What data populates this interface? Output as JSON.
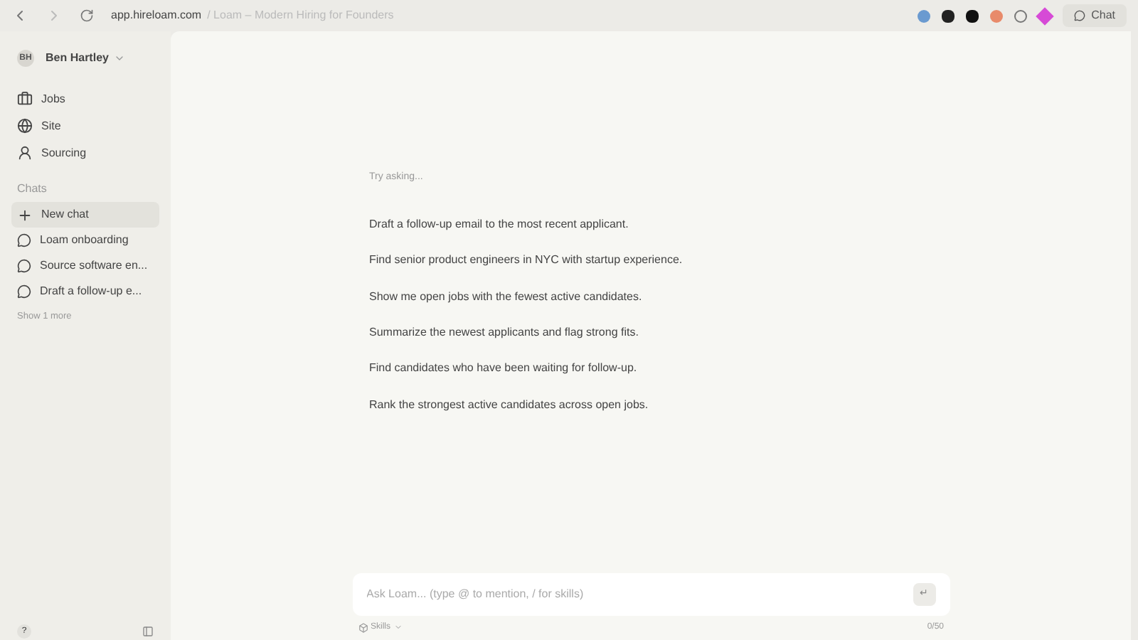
{
  "browser": {
    "url": "app.hireloam.com",
    "page_title": "/ Loam – Modern Hiring for Founders",
    "chat_button": "Chat"
  },
  "sidebar": {
    "avatar": "BH",
    "user": "Ben Hartley",
    "nav": [
      {
        "label": "Jobs",
        "kind": "briefcase"
      },
      {
        "label": "Site",
        "kind": "globe"
      },
      {
        "label": "Sourcing",
        "kind": "person"
      }
    ],
    "chats_heading": "Chats",
    "chats": [
      {
        "label": "New chat",
        "kind": "new",
        "selected": true
      },
      {
        "label": "Loam onboarding",
        "kind": "chat",
        "selected": false
      },
      {
        "label": "Source software en...",
        "kind": "chat",
        "selected": false
      },
      {
        "label": "Draft a follow-up e...",
        "kind": "chat",
        "selected": false
      }
    ],
    "show_more": "Show 1 more",
    "help": "?"
  },
  "main": {
    "hint": "Try asking...",
    "suggestions": [
      "Draft a follow-up email to the most recent applicant.",
      "Find senior product engineers in NYC with startup experience.",
      "Show me open jobs with the fewest active candidates.",
      "Summarize the newest applicants and flag strong fits.",
      "Find candidates who have been waiting for follow-up.",
      "Rank the strongest active candidates across open jobs."
    ],
    "input": {
      "placeholder": "Ask Loam... (type @ to mention, / for skills)",
      "send": "↵"
    },
    "skills": "Skills",
    "counter": "0/50"
  }
}
